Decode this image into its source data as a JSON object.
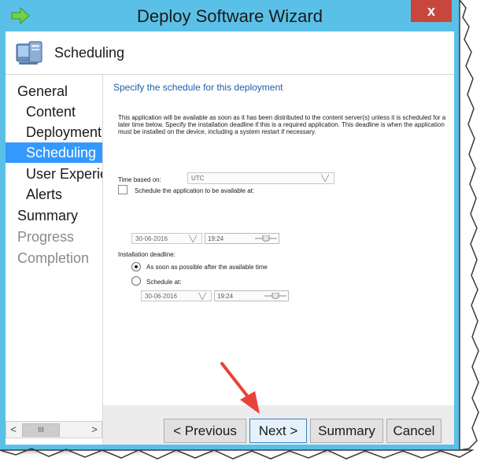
{
  "window": {
    "title": "Deploy Software Wizard",
    "close_glyph": "x"
  },
  "header": {
    "title": "Scheduling",
    "icon": "computer-icon"
  },
  "nav": {
    "items": [
      {
        "label": "General",
        "level": 1,
        "state": "normal"
      },
      {
        "label": "Content",
        "level": 2,
        "state": "normal"
      },
      {
        "label": "Deployment",
        "level": 2,
        "state": "normal"
      },
      {
        "label": "Scheduling",
        "level": 2,
        "state": "active"
      },
      {
        "label": "User Experie",
        "level": 2,
        "state": "normal"
      },
      {
        "label": "Alerts",
        "level": 2,
        "state": "normal"
      },
      {
        "label": "Summary",
        "level": 1,
        "state": "normal"
      },
      {
        "label": "Progress",
        "level": 1,
        "state": "disabled"
      },
      {
        "label": "Completion",
        "level": 1,
        "state": "disabled"
      }
    ],
    "scroll_left": "<",
    "scroll_right": ">",
    "scroll_thumb": "III"
  },
  "content": {
    "heading": "Specify the schedule for this deployment",
    "description": "This application will be available as soon as it has been distributed to the content server(s) unless it is scheduled for a later time below. Specify the installation deadline if this is a required application. This deadline is when the application must be installed on the device, including a system restart if necessary.",
    "time_based_label": "Time based on:",
    "time_based_value": "UTC",
    "schedule_available_label": "Schedule the application to be available at:",
    "available_date": "30-06-2016",
    "available_time": "19:24",
    "deadline_label": "Installation deadline:",
    "asap_label": "As soon as possible after the available time",
    "schedule_at_label": "Schedule at:",
    "deadline_date": "30-06-2016",
    "deadline_time": "19:24"
  },
  "footer": {
    "previous": "< Previous",
    "next": "Next >",
    "summary": "Summary",
    "cancel": "Cancel"
  },
  "colors": {
    "titlebar": "#5bc0e8",
    "close": "#c9463d",
    "nav_active": "#3399ff",
    "heading": "#1e5fa8",
    "arrow": "#e8423a"
  }
}
